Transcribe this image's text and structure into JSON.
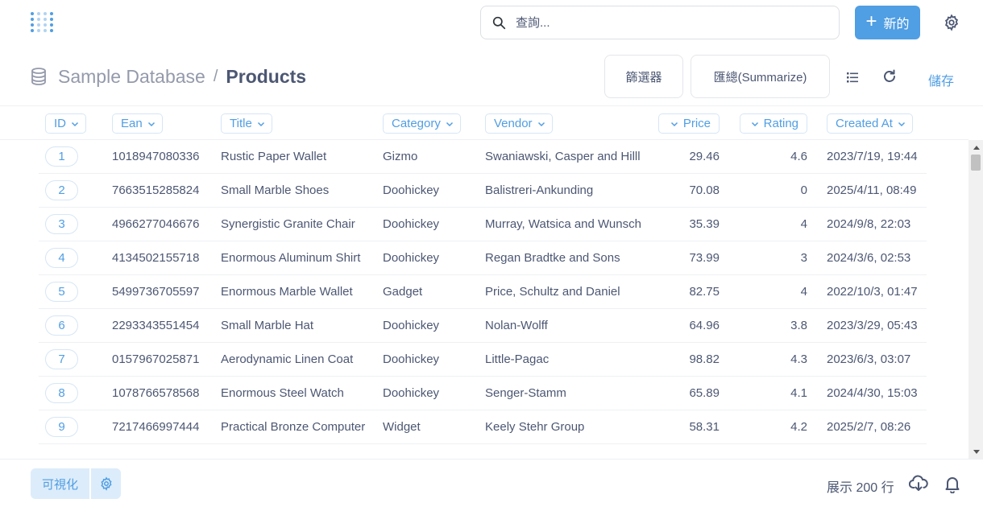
{
  "topbar": {
    "search_placeholder": "查詢...",
    "new_label": "新的"
  },
  "header": {
    "database": "Sample Database",
    "separator": "/",
    "table": "Products",
    "filter_label": "篩選器",
    "summarize_label": "匯總(Summarize)",
    "save_label": "儲存"
  },
  "columns": [
    {
      "label": "ID",
      "align": "left"
    },
    {
      "label": "Ean",
      "align": "left"
    },
    {
      "label": "Title",
      "align": "left"
    },
    {
      "label": "Category",
      "align": "left"
    },
    {
      "label": "Vendor",
      "align": "left"
    },
    {
      "label": "Price",
      "align": "right"
    },
    {
      "label": "Rating",
      "align": "right"
    },
    {
      "label": "Created At",
      "align": "left"
    }
  ],
  "rows": [
    {
      "id": "1",
      "ean": "1018947080336",
      "title": "Rustic Paper Wallet",
      "category": "Gizmo",
      "vendor": "Swaniawski, Casper and Hilll",
      "price": "29.46",
      "rating": "4.6",
      "created": "2023/7/19, 19:44"
    },
    {
      "id": "2",
      "ean": "7663515285824",
      "title": "Small Marble Shoes",
      "category": "Doohickey",
      "vendor": "Balistreri-Ankunding",
      "price": "70.08",
      "rating": "0",
      "created": "2025/4/11, 08:49"
    },
    {
      "id": "3",
      "ean": "4966277046676",
      "title": "Synergistic Granite Chair",
      "category": "Doohickey",
      "vendor": "Murray, Watsica and Wunsch",
      "price": "35.39",
      "rating": "4",
      "created": "2024/9/8, 22:03"
    },
    {
      "id": "4",
      "ean": "4134502155718",
      "title": "Enormous Aluminum Shirt",
      "category": "Doohickey",
      "vendor": "Regan Bradtke and Sons",
      "price": "73.99",
      "rating": "3",
      "created": "2024/3/6, 02:53"
    },
    {
      "id": "5",
      "ean": "5499736705597",
      "title": "Enormous Marble Wallet",
      "category": "Gadget",
      "vendor": "Price, Schultz and Daniel",
      "price": "82.75",
      "rating": "4",
      "created": "2022/10/3, 01:47"
    },
    {
      "id": "6",
      "ean": "2293343551454",
      "title": "Small Marble Hat",
      "category": "Doohickey",
      "vendor": "Nolan-Wolff",
      "price": "64.96",
      "rating": "3.8",
      "created": "2023/3/29, 05:43"
    },
    {
      "id": "7",
      "ean": "0157967025871",
      "title": "Aerodynamic Linen Coat",
      "category": "Doohickey",
      "vendor": "Little-Pagac",
      "price": "98.82",
      "rating": "4.3",
      "created": "2023/6/3, 03:07"
    },
    {
      "id": "8",
      "ean": "1078766578568",
      "title": "Enormous Steel Watch",
      "category": "Doohickey",
      "vendor": "Senger-Stamm",
      "price": "65.89",
      "rating": "4.1",
      "created": "2024/4/30, 15:03"
    },
    {
      "id": "9",
      "ean": "7217466997444",
      "title": "Practical Bronze Computer",
      "category": "Widget",
      "vendor": "Keely Stehr Group",
      "price": "58.31",
      "rating": "4.2",
      "created": "2025/2/7, 08:26"
    }
  ],
  "footer": {
    "visualize_label": "可視化",
    "row_count": "展示 200 行"
  },
  "colors": {
    "brand": "#509ee3",
    "text": "#4c5773",
    "muted": "#949aab"
  }
}
